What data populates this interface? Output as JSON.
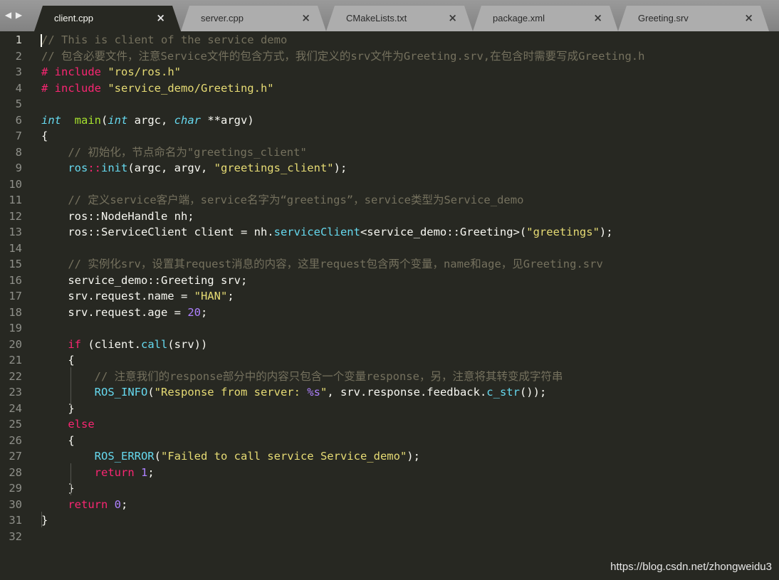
{
  "nav": {
    "back_icon": "◀",
    "forward_icon": "▶"
  },
  "tabs": [
    {
      "label": "client.cpp",
      "close": "×",
      "active": true
    },
    {
      "label": "server.cpp",
      "close": "×",
      "active": false
    },
    {
      "label": "CMakeLists.txt",
      "close": "×",
      "active": false
    },
    {
      "label": "package.xml",
      "close": "×",
      "active": false
    },
    {
      "label": "Greeting.srv",
      "close": "×",
      "active": false
    }
  ],
  "editor": {
    "current_line": 1,
    "line_numbers": [
      "1",
      "2",
      "3",
      "4",
      "5",
      "6",
      "7",
      "8",
      "9",
      "10",
      "11",
      "12",
      "13",
      "14",
      "15",
      "16",
      "17",
      "18",
      "19",
      "20",
      "21",
      "22",
      "23",
      "24",
      "25",
      "26",
      "27",
      "28",
      "29",
      "30",
      "31",
      "32"
    ],
    "lines": [
      [
        [
          "cm",
          "// This is client of the service demo"
        ]
      ],
      [
        [
          "cm",
          "// 包含必要文件，注意Service文件的包含方式，我们定义的srv文件为Greeting.srv,在包含时需要写成Greeting.h"
        ]
      ],
      [
        [
          "kw",
          "# include "
        ],
        [
          "str",
          "\"ros/ros.h\""
        ]
      ],
      [
        [
          "kw",
          "# include "
        ],
        [
          "str",
          "\"service_demo/Greeting.h\""
        ]
      ],
      [],
      [
        [
          "ty",
          "int"
        ],
        [
          "",
          "  "
        ],
        [
          "fn",
          "main"
        ],
        [
          "",
          "("
        ],
        [
          "ty",
          "int"
        ],
        [
          "",
          " argc, "
        ],
        [
          "ty",
          "char"
        ],
        [
          "",
          " **argv)"
        ]
      ],
      [
        [
          "",
          "{"
        ]
      ],
      [
        [
          "",
          "    "
        ],
        [
          "cm",
          "// 初始化，节点命名为\"greetings_client\""
        ]
      ],
      [
        [
          "",
          "    "
        ],
        [
          "sup",
          "ros"
        ],
        [
          "ns",
          "::"
        ],
        [
          "sup",
          "init"
        ],
        [
          "",
          "(argc, argv, "
        ],
        [
          "str",
          "\"greetings_client\""
        ],
        [
          "",
          ");"
        ]
      ],
      [],
      [
        [
          "",
          "    "
        ],
        [
          "cm",
          "// 定义service客户端，service名字为“greetings”，service类型为Service_demo"
        ]
      ],
      [
        [
          "",
          "    ros::NodeHandle nh;"
        ]
      ],
      [
        [
          "",
          "    ros::ServiceClient client = nh."
        ],
        [
          "sup",
          "serviceClient"
        ],
        [
          "",
          "<service_demo::Greeting>("
        ],
        [
          "str",
          "\"greetings\""
        ],
        [
          "",
          ");"
        ]
      ],
      [],
      [
        [
          "",
          "    "
        ],
        [
          "cm",
          "// 实例化srv，设置其request消息的内容，这里request包含两个变量，name和age，见Greeting.srv"
        ]
      ],
      [
        [
          "",
          "    service_demo::Greeting srv;"
        ]
      ],
      [
        [
          "",
          "    srv.request.name = "
        ],
        [
          "str",
          "\"HAN\""
        ],
        [
          "",
          ";"
        ]
      ],
      [
        [
          "",
          "    srv.request.age = "
        ],
        [
          "num",
          "20"
        ],
        [
          "",
          ";"
        ]
      ],
      [],
      [
        [
          "",
          "    "
        ],
        [
          "kw",
          "if"
        ],
        [
          "",
          " (client."
        ],
        [
          "sup",
          "call"
        ],
        [
          "",
          "(srv))"
        ]
      ],
      [
        [
          "",
          "    {"
        ]
      ],
      [
        [
          "",
          "        "
        ],
        [
          "cm",
          "// 注意我们的response部分中的内容只包含一个变量response，另，注意将其转变成字符串"
        ]
      ],
      [
        [
          "",
          "        "
        ],
        [
          "sup",
          "ROS_INFO"
        ],
        [
          "",
          "("
        ],
        [
          "str",
          "\"Response from server: "
        ],
        [
          "num",
          "%s"
        ],
        [
          "str",
          "\""
        ],
        [
          "",
          ", srv.response.feedback."
        ],
        [
          "sup",
          "c_str"
        ],
        [
          "",
          "());"
        ]
      ],
      [
        [
          "",
          "    }"
        ]
      ],
      [
        [
          "",
          "    "
        ],
        [
          "kw",
          "else"
        ]
      ],
      [
        [
          "",
          "    {"
        ]
      ],
      [
        [
          "",
          "        "
        ],
        [
          "sup",
          "ROS_ERROR"
        ],
        [
          "",
          "("
        ],
        [
          "str",
          "\"Failed to call service Service_demo\""
        ],
        [
          "",
          ");"
        ]
      ],
      [
        [
          "",
          "        "
        ],
        [
          "kw",
          "return"
        ],
        [
          "",
          " "
        ],
        [
          "num",
          "1"
        ],
        [
          "",
          ";"
        ]
      ],
      [
        [
          "",
          "    }"
        ]
      ],
      [
        [
          "",
          "    "
        ],
        [
          "kw",
          "return"
        ],
        [
          "",
          " "
        ],
        [
          "num",
          "0"
        ],
        [
          "",
          ";"
        ]
      ],
      [
        [
          "",
          "}"
        ]
      ],
      []
    ]
  },
  "watermark": "https://blog.csdn.net/zhongweidu3",
  "colors": {
    "background": "#272822",
    "comment": "#75715e",
    "string": "#e6db74",
    "keyword": "#f92672",
    "type": "#66d9ef",
    "function": "#a6e22e",
    "number": "#ae81ff"
  }
}
